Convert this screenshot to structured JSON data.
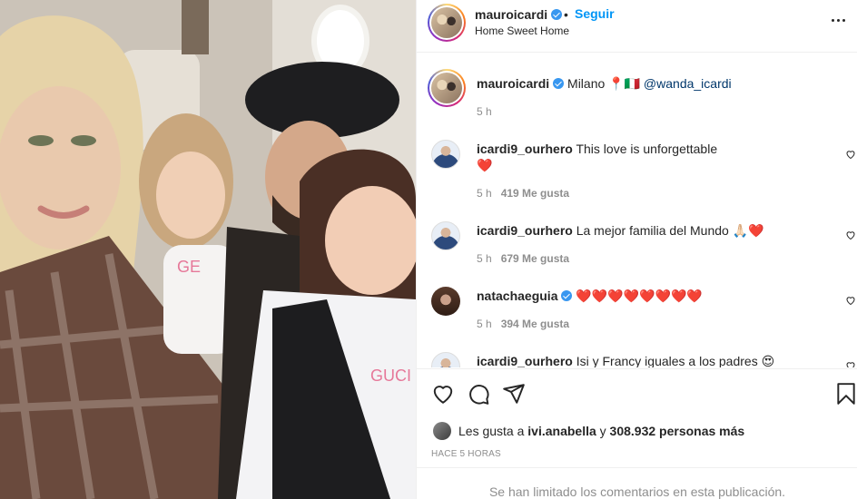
{
  "post": {
    "photo_alt": "Family selfie in an airplane cabin"
  },
  "header": {
    "username": "mauroicardi",
    "separator": "•",
    "follow_label": "Seguir",
    "location": "Home Sweet Home",
    "more_icon": "more-horizontal-icon"
  },
  "caption": {
    "username": "mauroicardi",
    "text": "Milano 📍🇮🇹",
    "mention": "@wanda_icardi",
    "time": "5 h"
  },
  "comments": [
    {
      "username": "icardi9_ourhero",
      "text": "This love is unforgettable",
      "emoji_line": "❤️",
      "time": "5 h",
      "likes": "419 Me gusta"
    },
    {
      "username": "icardi9_ourhero",
      "text": "La mejor familia del Mundo 🙏🏻❤️",
      "time": "5 h",
      "likes": "679 Me gusta"
    },
    {
      "username": "natachaeguia",
      "text": "❤️❤️❤️❤️❤️❤️❤️❤️",
      "time": "5 h",
      "likes": "394 Me gusta"
    },
    {
      "username": "icardi9_ourhero",
      "text": "Isi y Francy iguales a los padres 😍"
    }
  ],
  "actions": {
    "like_icon": "heart-icon",
    "comment_icon": "comment-icon",
    "share_icon": "share-icon",
    "save_icon": "bookmark-icon"
  },
  "likes_summary": {
    "prefix": "Les gusta a",
    "first_user": "ivi.anabella",
    "middle": "y",
    "others": "308.932 personas más"
  },
  "time_ago": "HACE 5 HORAS",
  "comments_limited": "Se han limitado los comentarios en esta publicación.",
  "colors": {
    "accent": "#0095f6",
    "verified": "#3897f0",
    "heart": "#e0245e",
    "muted": "#8e8e8e"
  }
}
